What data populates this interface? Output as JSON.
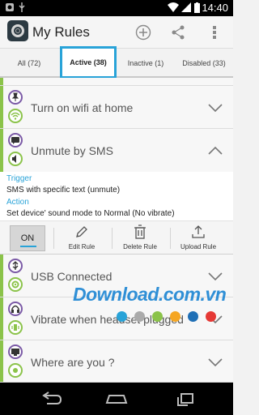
{
  "status_bar": {
    "time": "14:40"
  },
  "app": {
    "title": "My Rules"
  },
  "tabs": [
    {
      "label": "All (72)"
    },
    {
      "label": "Active (38)"
    },
    {
      "label": "Inactive (1)"
    },
    {
      "label": "Disabled (33)"
    }
  ],
  "rules": [
    {
      "name": "Turn on wifi at home"
    },
    {
      "name": "Unmute by SMS"
    },
    {
      "name": "USB Connected"
    },
    {
      "name": "Vibrate when headset plugged"
    },
    {
      "name": "Where are you ?"
    }
  ],
  "expanded": {
    "trigger_label": "Trigger",
    "trigger_value": "SMS with specific text (unmute)",
    "action_label": "Action",
    "action_value": "Set device' sound mode to Normal (No vibrate)"
  },
  "toolbar": {
    "toggle_label": "ON",
    "edit_label": "Edit Rule",
    "delete_label": "Delete Rule",
    "upload_label": "Upload Rule"
  },
  "watermark": {
    "text": "Download.com.vn",
    "dot_colors": [
      "#29a3d8",
      "#aaaaaa",
      "#8bc34a",
      "#f5a623",
      "#1f6fb5",
      "#e53935"
    ]
  },
  "colors": {
    "accent": "#29a3d8",
    "active_bar": "#8bc34a",
    "icon_ring": "#7b5aa6"
  }
}
